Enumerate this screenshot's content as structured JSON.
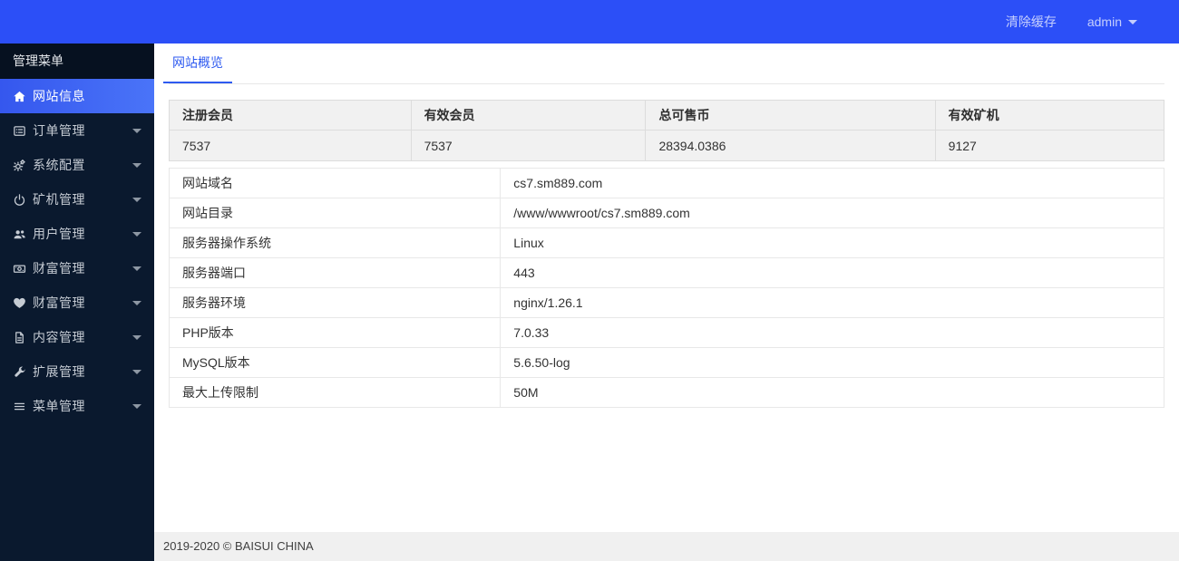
{
  "topbar": {
    "clear_cache_label": "清除缓存",
    "user_label": "admin"
  },
  "sidebar": {
    "header": "管理菜单",
    "items": [
      {
        "name": "site-info",
        "label": "网站信息",
        "icon": "home",
        "active": true,
        "caret": false
      },
      {
        "name": "order-manage",
        "label": "订单管理",
        "icon": "order",
        "active": false,
        "caret": true
      },
      {
        "name": "system-config",
        "label": "系统配置",
        "icon": "cogs",
        "active": false,
        "caret": true
      },
      {
        "name": "miner-manage",
        "label": "矿机管理",
        "icon": "power",
        "active": false,
        "caret": true
      },
      {
        "name": "user-manage",
        "label": "用户管理",
        "icon": "users",
        "active": false,
        "caret": true
      },
      {
        "name": "wealth-manage-1",
        "label": "财富管理",
        "icon": "money",
        "active": false,
        "caret": true
      },
      {
        "name": "wealth-manage-2",
        "label": "财富管理",
        "icon": "heart",
        "active": false,
        "caret": true
      },
      {
        "name": "content-manage",
        "label": "内容管理",
        "icon": "file",
        "active": false,
        "caret": true
      },
      {
        "name": "extension-manage",
        "label": "扩展管理",
        "icon": "wrench",
        "active": false,
        "caret": true
      },
      {
        "name": "menu-manage",
        "label": "菜单管理",
        "icon": "bars",
        "active": false,
        "caret": true
      }
    ]
  },
  "tabs": [
    {
      "label": "网站概览",
      "active": true
    }
  ],
  "stats": {
    "headers": [
      "注册会员",
      "有效会员",
      "总可售币",
      "有效矿机"
    ],
    "values": [
      "7537",
      "7537",
      "28394.0386",
      "9127"
    ]
  },
  "details": {
    "rows": [
      {
        "label": "网站域名",
        "value": "cs7.sm889.com"
      },
      {
        "label": "网站目录",
        "value": "/www/wwwroot/cs7.sm889.com"
      },
      {
        "label": "服务器操作系统",
        "value": "Linux"
      },
      {
        "label": "服务器端口",
        "value": "443"
      },
      {
        "label": "服务器环境",
        "value": "nginx/1.26.1"
      },
      {
        "label": "PHP版本",
        "value": "7.0.33"
      },
      {
        "label": "MySQL版本",
        "value": "5.6.50-log"
      },
      {
        "label": "最大上传限制",
        "value": "50M"
      }
    ]
  },
  "footer": {
    "copyright": "2019-2020 © BAISUI CHINA"
  },
  "colors": {
    "topbar_blue": "#2c4ff7",
    "sidebar_dark": "#0a192e",
    "active_item_blue": "#3e66f4",
    "tab_blue": "#2e5af0",
    "stats_bg": "#f1f1f1",
    "footer_bg": "#f0f0f0"
  }
}
